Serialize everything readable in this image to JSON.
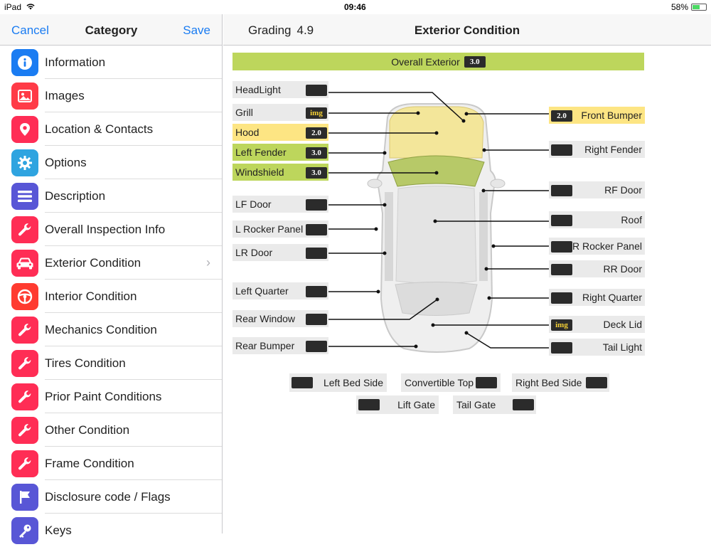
{
  "status": {
    "device": "iPad",
    "time": "09:46",
    "battery": "58%"
  },
  "sidebar": {
    "cancel": "Cancel",
    "title": "Category",
    "save": "Save",
    "items": [
      {
        "label": "Information",
        "icon": "info-icon",
        "color": "#1a7cf2"
      },
      {
        "label": "Images",
        "icon": "image-icon",
        "color": "#ff3b47"
      },
      {
        "label": "Location & Contacts",
        "icon": "location-pin-icon",
        "color": "#ff2d55"
      },
      {
        "label": "Options",
        "icon": "gear-icon",
        "color": "#2fa4e0"
      },
      {
        "label": "Description",
        "icon": "list-icon",
        "color": "#5856d6"
      },
      {
        "label": "Overall Inspection Info",
        "icon": "wrench-icon",
        "color": "#ff2d55"
      },
      {
        "label": "Exterior Condition",
        "icon": "car-icon",
        "color": "#ff2d55"
      },
      {
        "label": "Interior Condition",
        "icon": "steering-wheel-icon",
        "color": "#ff3b30"
      },
      {
        "label": "Mechanics Condition",
        "icon": "wrench-icon",
        "color": "#ff2d55"
      },
      {
        "label": "Tires Condition",
        "icon": "wrench-icon",
        "color": "#ff2d55"
      },
      {
        "label": "Prior Paint Conditions",
        "icon": "wrench-icon",
        "color": "#ff2d55"
      },
      {
        "label": "Other Condition",
        "icon": "wrench-icon",
        "color": "#ff2d55"
      },
      {
        "label": "Frame Condition",
        "icon": "wrench-icon",
        "color": "#ff2d55"
      },
      {
        "label": "Disclosure code / Flags",
        "icon": "flag-icon",
        "color": "#5856d6"
      },
      {
        "label": "Keys",
        "icon": "key-icon",
        "color": "#5856d6"
      }
    ]
  },
  "main": {
    "grading_label": "Grading",
    "grading_value": "4.9",
    "title": "Exterior Condition",
    "overall_label": "Overall Exterior",
    "overall_score": "3.0",
    "left_parts": [
      {
        "label": "HeadLight",
        "score": ""
      },
      {
        "label": "Grill",
        "score": "img"
      },
      {
        "label": "Hood",
        "score": "2.0"
      },
      {
        "label": "Left Fender",
        "score": "3.0"
      },
      {
        "label": "Windshield",
        "score": "3.0"
      },
      {
        "label": "LF Door",
        "score": ""
      },
      {
        "label": "L Rocker Panel",
        "score": ""
      },
      {
        "label": "LR Door",
        "score": ""
      },
      {
        "label": "Left Quarter",
        "score": ""
      },
      {
        "label": "Rear Window",
        "score": ""
      },
      {
        "label": "Rear Bumper",
        "score": ""
      }
    ],
    "right_parts": [
      {
        "label": "Front Bumper",
        "score": "2.0"
      },
      {
        "label": "Right Fender",
        "score": ""
      },
      {
        "label": "RF Door",
        "score": ""
      },
      {
        "label": "Roof",
        "score": ""
      },
      {
        "label": "R Rocker Panel",
        "score": ""
      },
      {
        "label": "RR Door",
        "score": ""
      },
      {
        "label": "Right Quarter",
        "score": ""
      },
      {
        "label": "Deck Lid",
        "score": "img"
      },
      {
        "label": "Tail Light",
        "score": ""
      }
    ],
    "bottom_parts": [
      {
        "label": "Left Bed Side",
        "score": ""
      },
      {
        "label": "Convertible Top",
        "score": ""
      },
      {
        "label": "Right Bed Side",
        "score": ""
      },
      {
        "label": "Lift Gate",
        "score": ""
      },
      {
        "label": "Tail Gate",
        "score": ""
      }
    ]
  },
  "colors": {
    "accent": "#1a7cf2",
    "green": "#bdd65c",
    "yellow": "#fde583",
    "badge": "#2b2b2b"
  }
}
